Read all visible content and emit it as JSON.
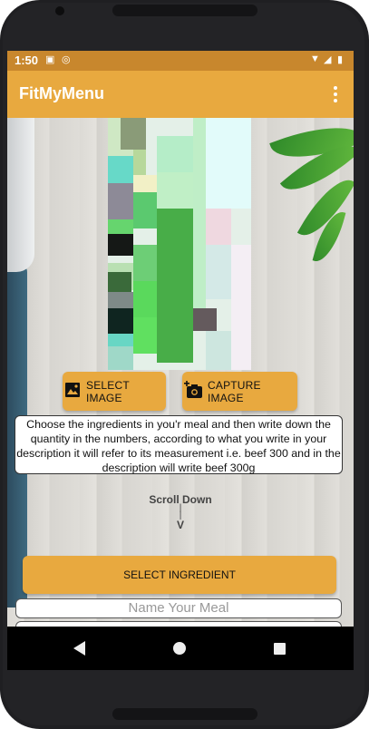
{
  "status_bar": {
    "time": "1:50",
    "icons": [
      "image-notification-icon",
      "sync-notification-icon",
      "wifi-icon",
      "signal-icon",
      "battery-icon"
    ]
  },
  "app_bar": {
    "title": "FitMyMenu",
    "menu_icon": "overflow-menu-icon"
  },
  "buttons": {
    "select_image": "SELECT IMAGE",
    "capture_image": "CAPTURE IMAGE",
    "select_ingredient": "SELECT INGREDIENT"
  },
  "description": "Choose the ingredients in you'r meal and then write down the quantity in the numbers, according to what you write in your description it will refer to its measurement i.e. beef 300 and in the description will write beef 300g",
  "scroll_hint": {
    "title": "Scroll Down",
    "line1": "|",
    "line2": "|",
    "arrow": "V"
  },
  "inputs": {
    "meal_name_placeholder": "Name Your Meal",
    "second_field_placeholder": ""
  },
  "colors": {
    "accent": "#e8a93f",
    "status_bar": "#c8872d",
    "nav_bar": "#000000"
  }
}
